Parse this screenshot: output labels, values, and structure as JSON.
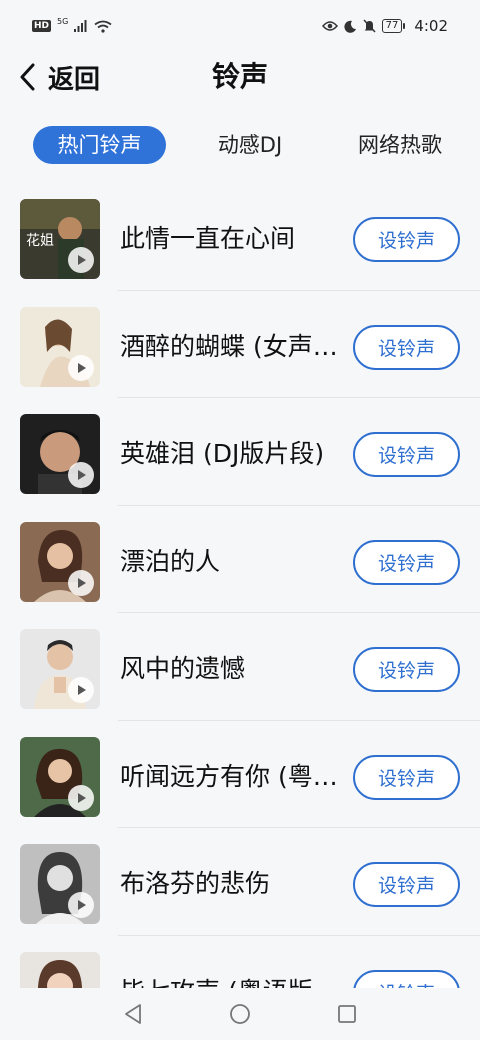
{
  "status_bar": {
    "hd": "HD",
    "signal_label": "5G",
    "battery": "77",
    "time": "4:02"
  },
  "header": {
    "back_label": "返回",
    "title": "铃声"
  },
  "tabs": [
    {
      "label": "热门铃声",
      "active": true
    },
    {
      "label": "动感DJ",
      "active": false
    },
    {
      "label": "网络热歌",
      "active": false
    }
  ],
  "songs": [
    {
      "title": "此情一直在心间",
      "button": "设铃声"
    },
    {
      "title": "酒醉的蝴蝶 (女声…",
      "button": "设铃声"
    },
    {
      "title": "英雄泪 (DJ版片段)",
      "button": "设铃声"
    },
    {
      "title": "漂泊的人",
      "button": "设铃声"
    },
    {
      "title": "风中的遗憾",
      "button": "设铃声"
    },
    {
      "title": "听闻远方有你 (粤…",
      "button": "设铃声"
    },
    {
      "title": "布洛芬的悲伤",
      "button": "设铃声"
    },
    {
      "title": "毕七攻声 (粤语版",
      "button": "设铃声"
    }
  ],
  "colors": {
    "accent": "#2f72d8",
    "button_border": "#2f6fd0"
  }
}
